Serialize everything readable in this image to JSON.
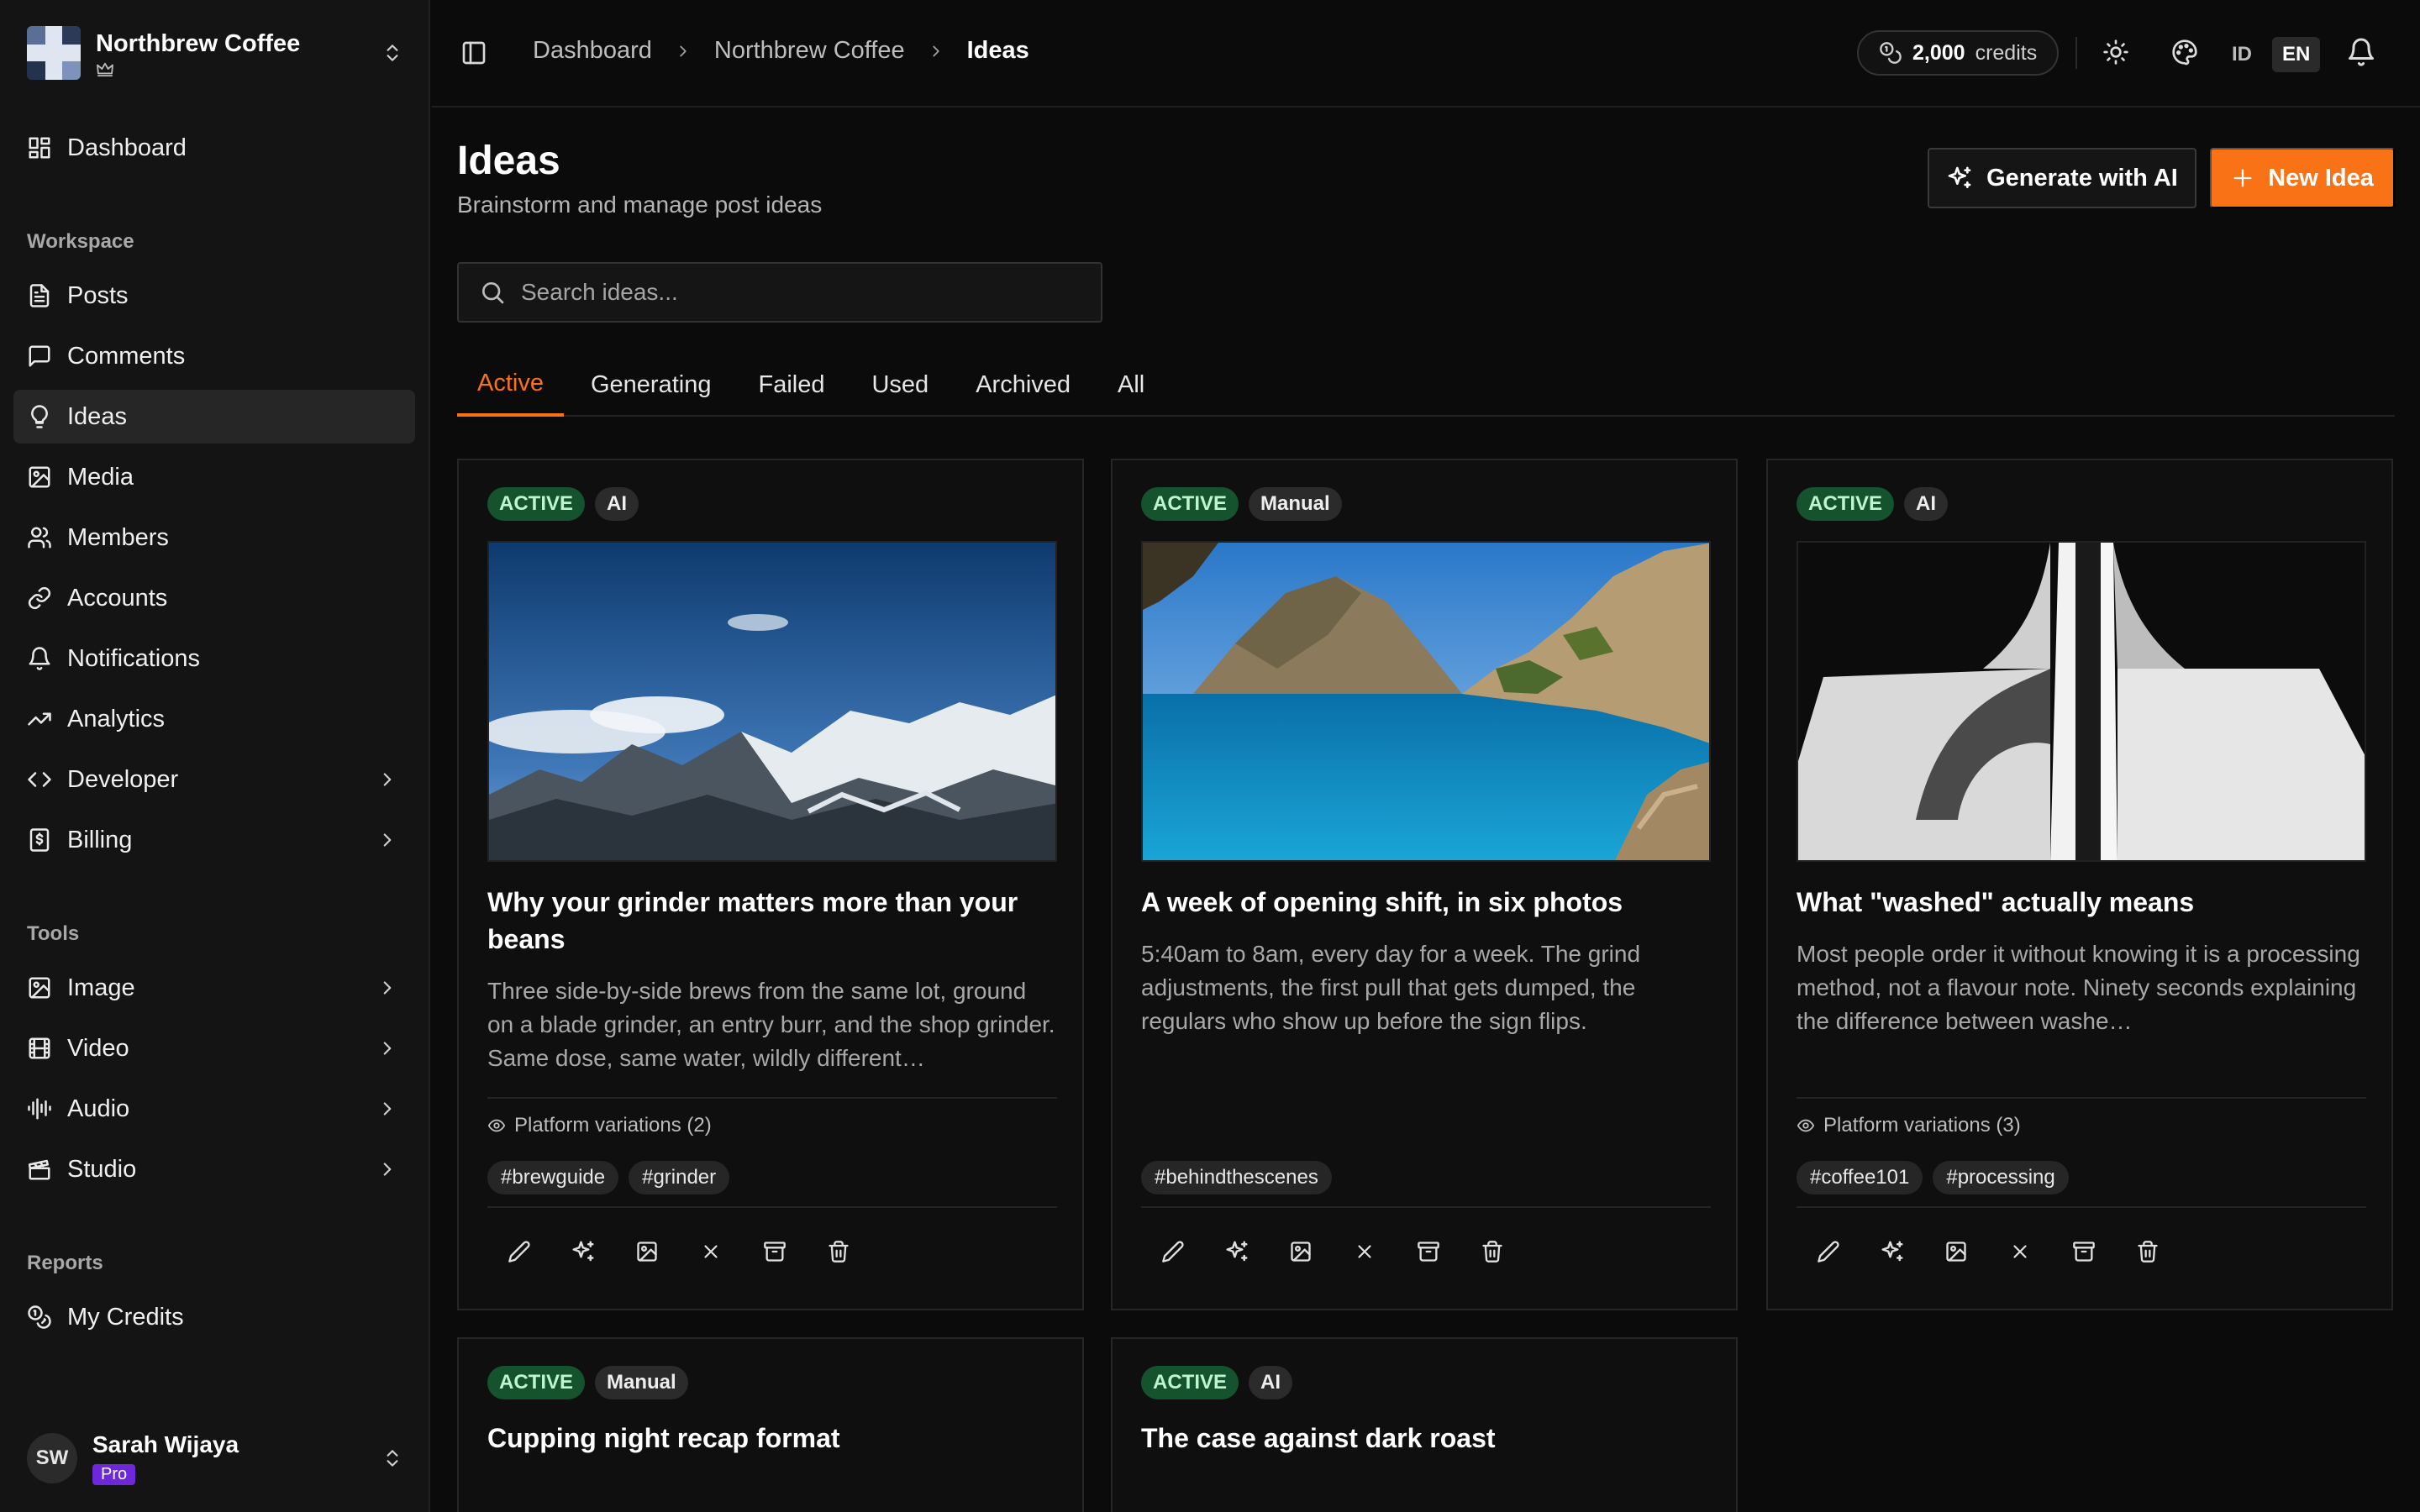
{
  "org": {
    "name": "Northbrew Coffee"
  },
  "sidebar": {
    "top_item": "Dashboard",
    "workspace_label": "Workspace",
    "workspace": [
      {
        "label": "Posts"
      },
      {
        "label": "Comments"
      },
      {
        "label": "Ideas"
      },
      {
        "label": "Media"
      },
      {
        "label": "Members"
      },
      {
        "label": "Accounts"
      },
      {
        "label": "Notifications"
      },
      {
        "label": "Analytics"
      },
      {
        "label": "Developer"
      },
      {
        "label": "Billing"
      }
    ],
    "tools_label": "Tools",
    "tools": [
      {
        "label": "Image"
      },
      {
        "label": "Video"
      },
      {
        "label": "Audio"
      },
      {
        "label": "Studio"
      }
    ],
    "reports_label": "Reports",
    "reports": [
      {
        "label": "My Credits"
      }
    ]
  },
  "user": {
    "initials": "SW",
    "name": "Sarah Wijaya",
    "plan": "Pro"
  },
  "header": {
    "breadcrumb": [
      "Dashboard",
      "Northbrew Coffee",
      "Ideas"
    ],
    "credits_count": "2,000",
    "credits_label": "credits",
    "lang_id": "ID",
    "lang_en": "EN"
  },
  "page": {
    "title": "Ideas",
    "subtitle": "Brainstorm and manage post ideas",
    "generate_label": "Generate with AI",
    "new_label": "New Idea",
    "search_placeholder": "Search ideas..."
  },
  "tabs": [
    "Active",
    "Generating",
    "Failed",
    "Used",
    "Archived",
    "All"
  ],
  "colors": {
    "accent": "#f97316",
    "status_active_bg": "#14532d",
    "pro": "#6d28d9"
  },
  "cards": [
    {
      "status": "ACTIVE",
      "source": "AI",
      "title": "Why your grinder matters more than your beans",
      "description": "Three side-by-side brews from the same lot, ground on a blade grinder, an entry burr, and the shop grinder. Same dose, same water, wildly different…",
      "variations": "Platform variations (2)",
      "tags": [
        "#brewguide",
        "#grinder"
      ]
    },
    {
      "status": "ACTIVE",
      "source": "Manual",
      "title": "A week of opening shift, in six photos",
      "description": "5:40am to 8am, every day for a week. The grind adjustments, the first pull that gets dumped, the regulars who show up before the sign flips.",
      "tags": [
        "#behindthescenes"
      ]
    },
    {
      "status": "ACTIVE",
      "source": "AI",
      "title": "What \"washed\" actually means",
      "description": "Most people order it without knowing it is a processing method, not a flavour note. Ninety seconds explaining the difference between washe…",
      "variations": "Platform variations (3)",
      "tags": [
        "#coffee101",
        "#processing"
      ]
    },
    {
      "status": "ACTIVE",
      "source": "Manual",
      "title": "Cupping night recap format"
    },
    {
      "status": "ACTIVE",
      "source": "AI",
      "title": "The case against dark roast"
    }
  ]
}
